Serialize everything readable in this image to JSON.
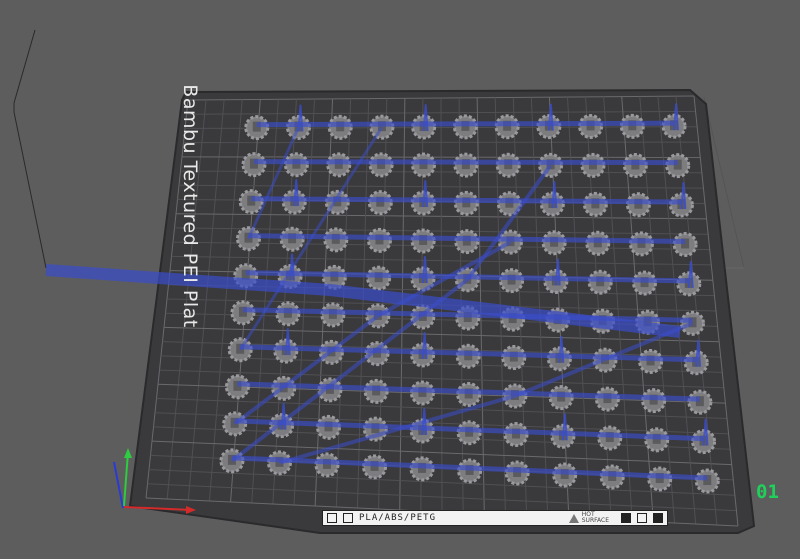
{
  "plate": {
    "name": "Bambu Textured PEI Plat",
    "material_label": "PLA/ABS/PETG",
    "warning_label": "HOT\nSURFACE",
    "plate_number": "01"
  },
  "colors": {
    "background": "#5d5d5e",
    "plate": "#3a3a3c",
    "grid": "#56565a",
    "travel_path": "#3a4dcc",
    "parts": "#7d7d80",
    "axis_x": "#d42a2a",
    "axis_y": "#2ecc40",
    "axis_z": "#2a3ad4",
    "plate_number": "#1fd15a"
  },
  "icons": [
    "plate-type-icon",
    "plate-settings-icon",
    "warning-icon",
    "bin-icon",
    "square-icon",
    "bin-icon-2"
  ],
  "parts": {
    "rows": 10,
    "cols": 11
  }
}
